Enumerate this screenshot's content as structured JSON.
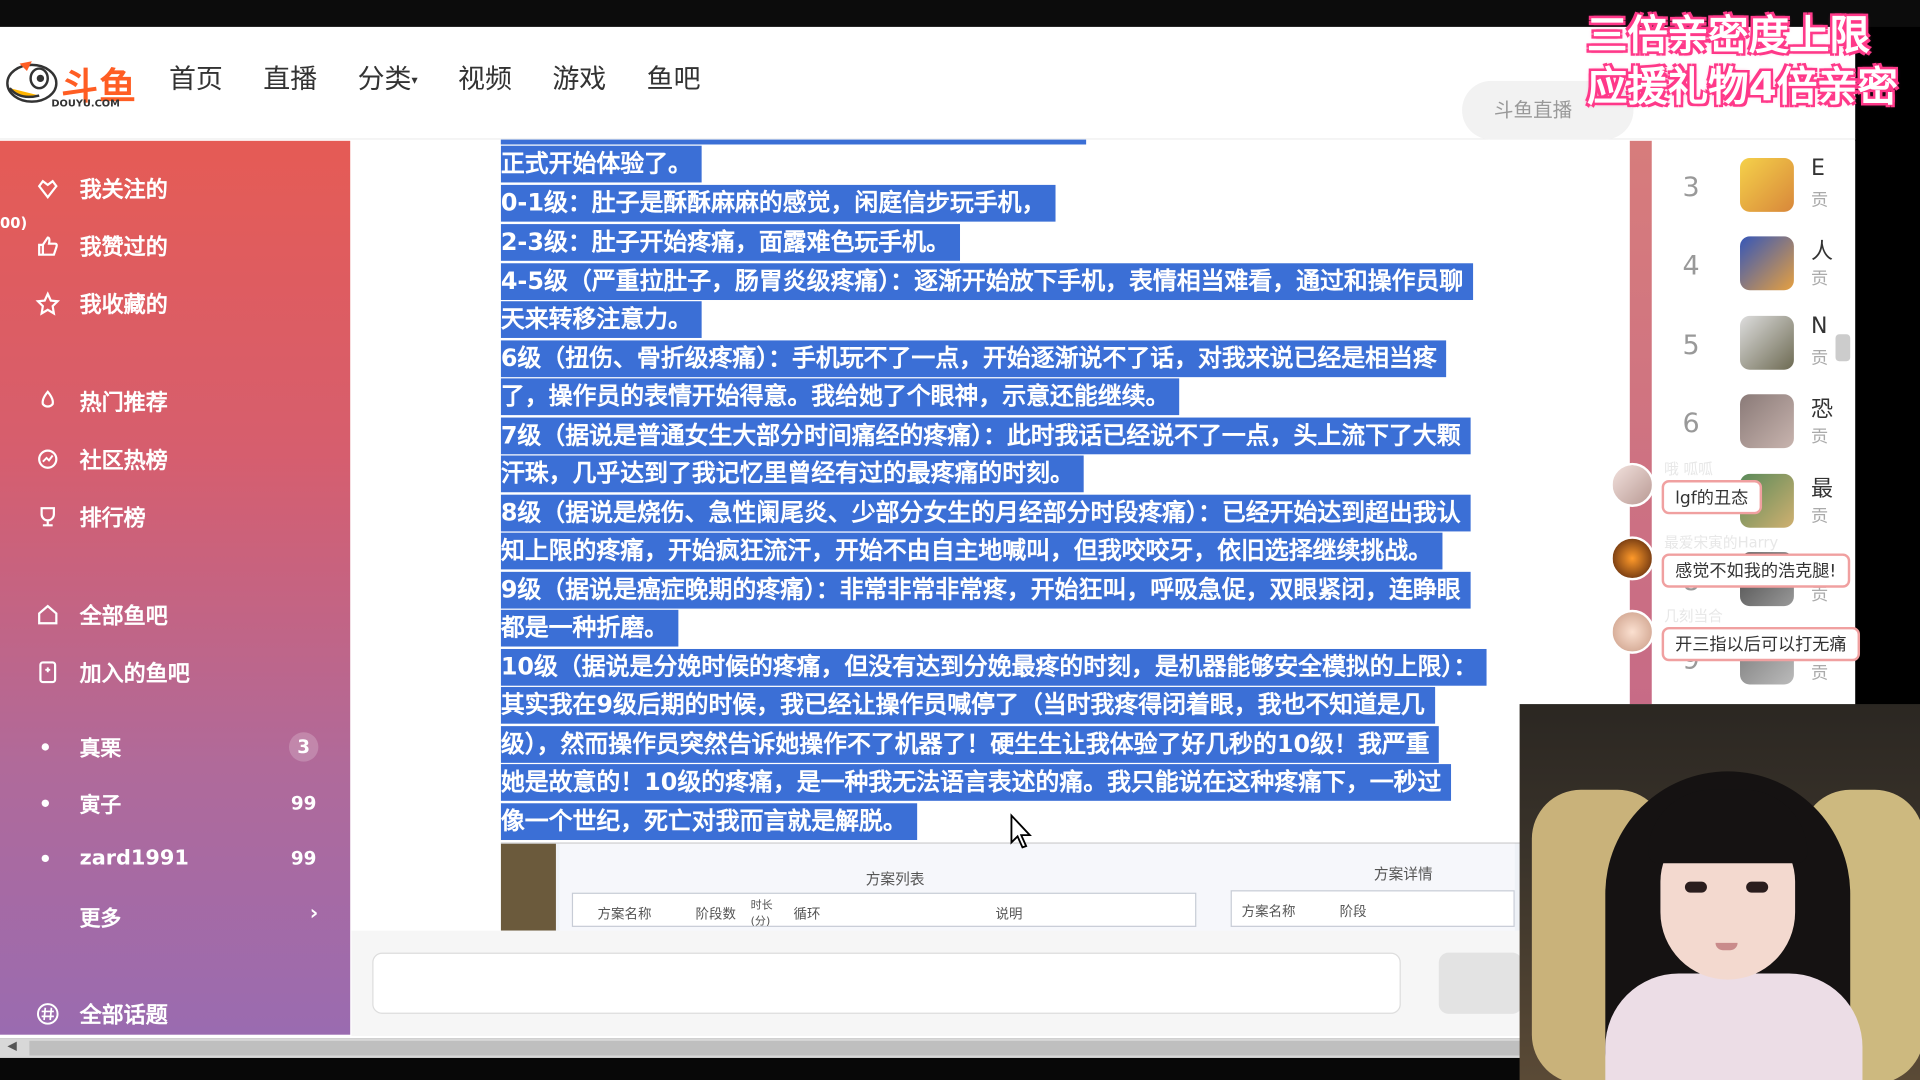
{
  "header": {
    "logo_text": "斗鱼",
    "logo_en": "DOUYU.COM",
    "nav": [
      "首页",
      "直播",
      "分类",
      "视频",
      "游戏",
      "鱼吧"
    ],
    "search_placeholder": "斗鱼直播"
  },
  "overlay": {
    "line1": "三倍亲密度上限",
    "line2": "应援礼物4倍亲密"
  },
  "sidebar": {
    "peek": "00)",
    "items": [
      {
        "label": "我关注的",
        "icon": "heart-crown-icon"
      },
      {
        "label": "我赞过的",
        "icon": "thumbs-up-icon"
      },
      {
        "label": "我收藏的",
        "icon": "star-icon"
      },
      {
        "label": "热门推荐",
        "icon": "flame-icon"
      },
      {
        "label": "社区热榜",
        "icon": "chart-icon"
      },
      {
        "label": "排行榜",
        "icon": "trophy-icon"
      },
      {
        "label": "全部鱼吧",
        "icon": "home-icon"
      },
      {
        "label": "加入的鱼吧",
        "icon": "bookmark-icon"
      }
    ],
    "groups": [
      {
        "label": "真栗",
        "count": "3"
      },
      {
        "label": "寅子",
        "count": "99"
      },
      {
        "label": "zard1991",
        "count": "99"
      }
    ],
    "more_label": "更多",
    "topics_label": "全部话题"
  },
  "doc": {
    "lines": [
      "正式开始体验了。",
      "0-1级：肚子是酥酥麻麻的感觉，闲庭信步玩手机，",
      "2-3级：肚子开始疼痛，面露难色玩手机。",
      "4-5级（严重拉肚子，肠胃炎级疼痛）：逐渐开始放下手机，表情相当难看，通过和操作员聊",
      "天来转移注意力。",
      "6级（扭伤、骨折级疼痛）：手机玩不了一点，开始逐渐说不了话，对我来说已经是相当疼",
      "了，操作员的表情开始得意。我给她了个眼神，示意还能继续。",
      "7级（据说是普通女生大部分时间痛经的疼痛）：此时我话已经说不了一点，头上流下了大颗",
      "汗珠，几乎达到了我记忆里曾经有过的最疼痛的时刻。",
      "8级（据说是烧伤、急性阑尾炎、少部分女生的月经部分时段疼痛）：已经开始达到超出我认",
      "知上限的疼痛，开始疯狂流汗，开始不由自主地喊叫，但我咬咬牙，依旧选择继续挑战。",
      "9级（据说是癌症晚期的疼痛）：非常非常非常疼，开始狂叫，呼吸急促，双眼紧闭，连睁眼",
      "都是一种折磨。",
      "10级（据说是分娩时候的疼痛，但没有达到分娩最疼的时刻，是机器能够安全模拟的上限）：",
      "其实我在9级后期的时候，我已经让操作员喊停了（当时我疼得闭着眼，我也不知道是几",
      "级），然而操作员突然告诉她操作不了机器了！硬生生让我体验了好几秒的10级！我严重",
      "她是故意的！10级的疼痛，是一种我无法语言表述的痛。我只能说在这种疼痛下，一秒过",
      "像一个世纪，死亡对我而言就是解脱。"
    ],
    "image_labels": {
      "list_title": "方案列表",
      "detail_title": "方案详情",
      "col1": "方案名称",
      "col2": "阶段数",
      "col3": "时长(分)",
      "col4": "循环",
      "col5": "说明",
      "col6": "方案名称",
      "col7": "阶段"
    }
  },
  "rank": [
    {
      "num": "3",
      "name": "E",
      "sub": "贡"
    },
    {
      "num": "4",
      "name": "人",
      "sub": "贡"
    },
    {
      "num": "5",
      "name": "N",
      "sub": "贡"
    },
    {
      "num": "6",
      "name": "恐",
      "sub": "贡"
    },
    {
      "num": "7",
      "name": "最",
      "sub": "贡"
    },
    {
      "num": "8",
      "name": "纟",
      "sub": "贡"
    },
    {
      "num": "9",
      "name": "友",
      "sub": "贡"
    }
  ],
  "chats": [
    {
      "user": "哦 呱呱",
      "text": "lgf的丑态"
    },
    {
      "user": "最爱宋寅的Harry",
      "text": "感觉不如我的浩克腿!"
    },
    {
      "user": "几刻当合",
      "text": "开三指以后可以打无痛"
    }
  ],
  "colors": {
    "accent": "#ff5d23",
    "highlight": "#3b6fd6",
    "promo_outline": "#ff3a8a"
  }
}
